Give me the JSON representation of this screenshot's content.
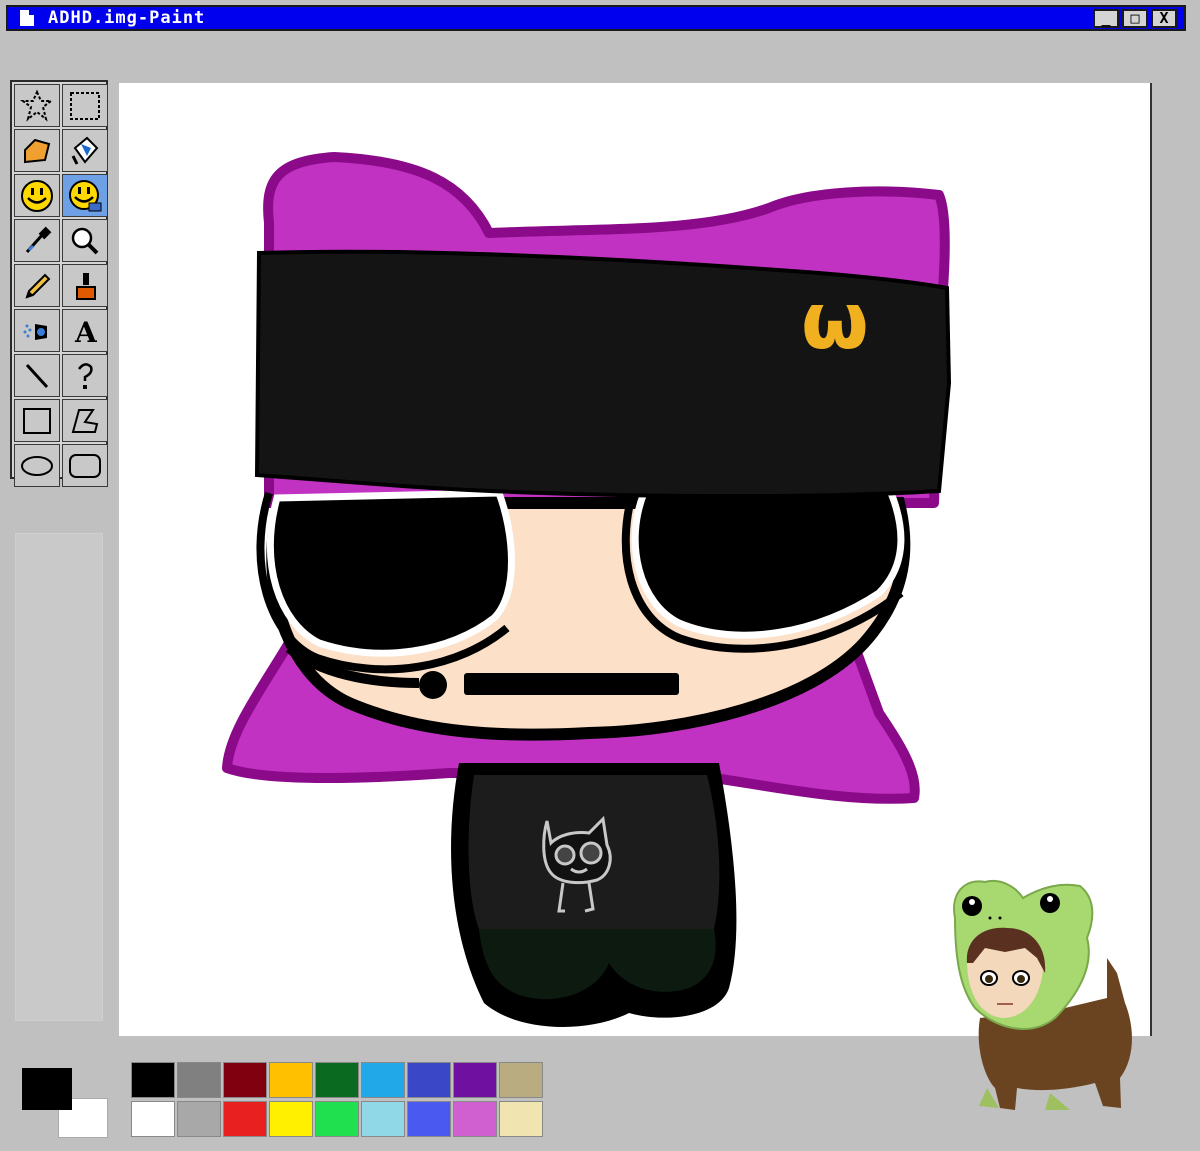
{
  "window": {
    "title": "ADHD.img-Paint",
    "icon": "document-icon",
    "controls": {
      "minimize": "_",
      "maximize": "□",
      "close": "X"
    }
  },
  "toolbox": {
    "tools": [
      {
        "name": "free-select",
        "icon": "star-select-icon"
      },
      {
        "name": "rect-select",
        "icon": "rectangle-select-icon"
      },
      {
        "name": "eraser",
        "icon": "eraser-icon"
      },
      {
        "name": "fill",
        "icon": "paint-bucket-icon"
      },
      {
        "name": "smiley",
        "icon": "smiley-icon"
      },
      {
        "name": "smiley-tool-active",
        "icon": "smiley-tool-icon",
        "active": true
      },
      {
        "name": "color-picker",
        "icon": "eyedropper-icon"
      },
      {
        "name": "magnifier",
        "icon": "magnifier-icon"
      },
      {
        "name": "pencil",
        "icon": "pencil-icon"
      },
      {
        "name": "brush",
        "icon": "brush-icon"
      },
      {
        "name": "airbrush",
        "icon": "airbrush-icon"
      },
      {
        "name": "text",
        "icon": "text-icon"
      },
      {
        "name": "line",
        "icon": "line-icon"
      },
      {
        "name": "curve",
        "icon": "curve-icon"
      },
      {
        "name": "rectangle",
        "icon": "rectangle-icon"
      },
      {
        "name": "polygon",
        "icon": "polygon-icon"
      },
      {
        "name": "ellipse",
        "icon": "ellipse-icon"
      },
      {
        "name": "rounded-rectangle",
        "icon": "rounded-rectangle-icon"
      }
    ]
  },
  "colors": {
    "foreground": "#000000",
    "background": "#ffffff",
    "palette_top": [
      "#000000",
      "#808080",
      "#800010",
      "#ffc000",
      "#0a6a20",
      "#20a8e8",
      "#3a48c8",
      "#7010a0",
      "#b8ac80"
    ],
    "palette_bottom": [
      "#ffffff",
      "#a8a8a8",
      "#e82020",
      "#fff000",
      "#20e050",
      "#90d8e8",
      "#4a5af0",
      "#d060d0",
      "#f0e4b0"
    ]
  },
  "canvas": {
    "badge_text": "ω",
    "hair_color": "#c232c2",
    "hat_color": "#141414",
    "skin_color": "#fce0c8"
  }
}
